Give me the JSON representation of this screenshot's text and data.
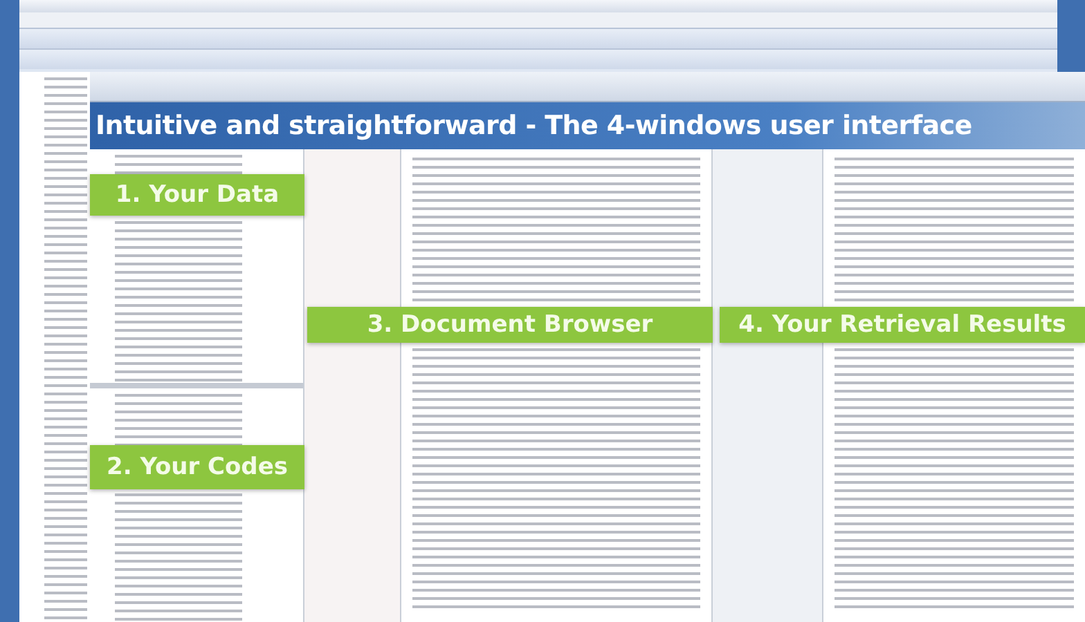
{
  "banner": {
    "title": "Intuitive and straightforward - The 4-windows user interface"
  },
  "labels": [
    {
      "kind": "data",
      "text": "1. Your Data"
    },
    {
      "kind": "codes",
      "text": "2. Your Codes"
    },
    {
      "kind": "browser",
      "text": "3. Document Browser"
    },
    {
      "kind": "retrieval",
      "text": "4. Your Retrieval Results"
    }
  ]
}
